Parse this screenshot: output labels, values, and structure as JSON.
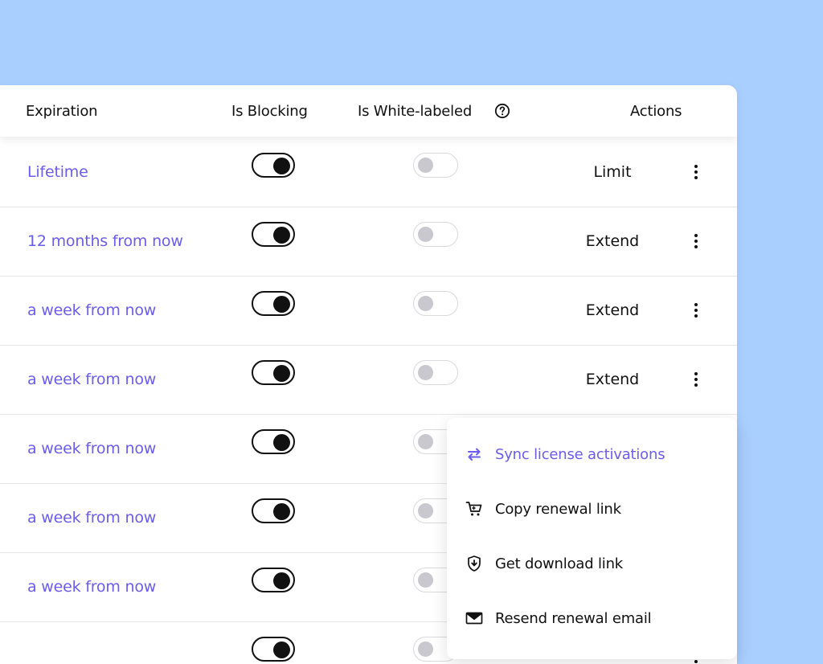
{
  "table": {
    "columns": {
      "expiration": "Expiration",
      "is_blocking": "Is Blocking",
      "is_white_labeled": "Is White-labeled",
      "actions": "Actions"
    },
    "help_icon": "question-circle-icon",
    "rows": [
      {
        "expiration": "Lifetime",
        "is_blocking": true,
        "is_white_labeled": false,
        "action": "Limit"
      },
      {
        "expiration": "12 months from now",
        "is_blocking": true,
        "is_white_labeled": false,
        "action": "Extend"
      },
      {
        "expiration": "a week from now",
        "is_blocking": true,
        "is_white_labeled": false,
        "action": "Extend"
      },
      {
        "expiration": "a week from now",
        "is_blocking": true,
        "is_white_labeled": false,
        "action": "Extend"
      },
      {
        "expiration": "a week from now",
        "is_blocking": true,
        "is_white_labeled": false,
        "action": ""
      },
      {
        "expiration": "a week from now",
        "is_blocking": true,
        "is_white_labeled": false,
        "action": ""
      },
      {
        "expiration": "a week from now",
        "is_blocking": true,
        "is_white_labeled": false,
        "action": ""
      },
      {
        "expiration": "",
        "is_blocking": true,
        "is_white_labeled": false,
        "action": ""
      }
    ]
  },
  "menu": {
    "items": [
      {
        "label": "Sync license activations",
        "icon": "sync-arrows-icon",
        "active": true
      },
      {
        "label": "Copy renewal link",
        "icon": "cart-icon",
        "active": false
      },
      {
        "label": "Get download link",
        "icon": "shield-download-icon",
        "active": false
      },
      {
        "label": "Resend renewal email",
        "icon": "envelope-icon",
        "active": false
      }
    ]
  },
  "colors": {
    "background": "#a9cfff",
    "accent": "#6b5cf0",
    "toggle_on": "#111111",
    "toggle_off_knob": "#c8c8ce"
  }
}
